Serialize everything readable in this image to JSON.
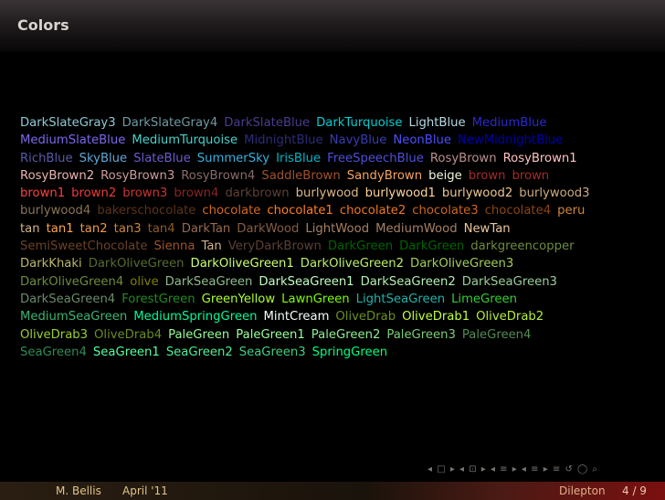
{
  "slide": {
    "title": "Colors",
    "lines": [
      [
        {
          "t": "DarkSlateGray3",
          "c": "#8fc9d6"
        },
        {
          "t": "DarkSlateGray4",
          "c": "#6e9aa3"
        },
        {
          "t": "DarkSlateBlue",
          "c": "#483d8b"
        },
        {
          "t": "DarkTurquoise",
          "c": "#00ced1"
        },
        {
          "t": "LightBlue",
          "c": "#b6d8e4"
        },
        {
          "t": "MediumBlue",
          "c": "#2a2acd"
        }
      ],
      [
        {
          "t": "MediumSlateBlue",
          "c": "#7b68ee"
        },
        {
          "t": "MediumTurquoise",
          "c": "#48d1cc"
        },
        {
          "t": "MidnightBlue",
          "c": "#2c2c7a"
        },
        {
          "t": "NavyBlue",
          "c": "#3a3ab4"
        },
        {
          "t": "NeonBlue",
          "c": "#4d4dff"
        },
        {
          "t": "NewMidnightBlue",
          "c": "#0000b0"
        }
      ],
      [
        {
          "t": "RichBlue",
          "c": "#5959ab"
        },
        {
          "t": "SkyBlue",
          "c": "#5fa6d6"
        },
        {
          "t": "SlateBlue",
          "c": "#6a5acd"
        },
        {
          "t": "SummerSky",
          "c": "#38b0de"
        },
        {
          "t": "IrisBlue",
          "c": "#03b4c8"
        },
        {
          "t": "FreeSpeechBlue",
          "c": "#4f4fd9"
        },
        {
          "t": "RosyBrown",
          "c": "#bc8f8f"
        },
        {
          "t": "RosyBrown1",
          "c": "#ffc1c1"
        }
      ],
      [
        {
          "t": "RosyBrown2",
          "c": "#eeb4b4"
        },
        {
          "t": "RosyBrown3",
          "c": "#cd9b9b"
        },
        {
          "t": "RosyBrown4",
          "c": "#8b6969"
        },
        {
          "t": "SaddleBrown",
          "c": "#a0522d"
        },
        {
          "t": "SandyBrown",
          "c": "#f4a460"
        },
        {
          "t": "beige",
          "c": "#f5f5dc"
        },
        {
          "t": "brown",
          "c": "#a52a2a"
        },
        {
          "t": "brown",
          "c": "#a52a2a"
        }
      ],
      [
        {
          "t": "brown1",
          "c": "#ff4040"
        },
        {
          "t": "brown2",
          "c": "#ee3b3b"
        },
        {
          "t": "brown3",
          "c": "#cd3333"
        },
        {
          "t": "brown4",
          "c": "#8b2323"
        },
        {
          "t": "darkbrown",
          "c": "#5c4033"
        },
        {
          "t": "burlywood",
          "c": "#deb887"
        },
        {
          "t": "burlywood1",
          "c": "#ffd39b"
        },
        {
          "t": "burlywood2",
          "c": "#eec591"
        },
        {
          "t": "burlywood3",
          "c": "#cdaa7d"
        }
      ],
      [
        {
          "t": "burlywood4",
          "c": "#8b7355"
        },
        {
          "t": "bakerschocolate",
          "c": "#5c3317"
        },
        {
          "t": "chocolate",
          "c": "#d2691e"
        },
        {
          "t": "chocolate1",
          "c": "#ff7f24"
        },
        {
          "t": "chocolate2",
          "c": "#ee7621"
        },
        {
          "t": "chocolate3",
          "c": "#cd661d"
        },
        {
          "t": "chocolate4",
          "c": "#8b4513"
        },
        {
          "t": "peru",
          "c": "#cd853f"
        }
      ],
      [
        {
          "t": "tan",
          "c": "#d2b48c"
        },
        {
          "t": "tan1",
          "c": "#ffa54f"
        },
        {
          "t": "tan2",
          "c": "#ee9a49"
        },
        {
          "t": "tan3",
          "c": "#cd853f"
        },
        {
          "t": "tan4",
          "c": "#8b5a2b"
        },
        {
          "t": "DarkTan",
          "c": "#97694f"
        },
        {
          "t": "DarkWood",
          "c": "#855e42"
        },
        {
          "t": "LightWood",
          "c": "#a68064"
        },
        {
          "t": "MediumWood",
          "c": "#a68064"
        },
        {
          "t": "NewTan",
          "c": "#ebc79e"
        }
      ],
      [
        {
          "t": "SemiSweetChocolate",
          "c": "#6b4226"
        },
        {
          "t": "Sienna",
          "c": "#a0522d"
        },
        {
          "t": "Tan",
          "c": "#d2b48c"
        },
        {
          "t": "VeryDarkBrown",
          "c": "#5c4033"
        },
        {
          "t": "DarkGreen",
          "c": "#006400"
        },
        {
          "t": "DarkGreen",
          "c": "#006400"
        },
        {
          "t": "darkgreencopper",
          "c": "#6e8b3d"
        }
      ],
      [
        {
          "t": "DarkKhaki",
          "c": "#bdb76b"
        },
        {
          "t": "DarkOliveGreen",
          "c": "#556b2f"
        },
        {
          "t": "DarkOliveGreen1",
          "c": "#caff70"
        },
        {
          "t": "DarkOliveGreen2",
          "c": "#bcee68"
        },
        {
          "t": "DarkOliveGreen3",
          "c": "#a2cd5a"
        }
      ],
      [
        {
          "t": "DarkOliveGreen4",
          "c": "#6e8b3d"
        },
        {
          "t": "olive",
          "c": "#808000"
        },
        {
          "t": "DarkSeaGreen",
          "c": "#8fbc8f"
        },
        {
          "t": "DarkSeaGreen1",
          "c": "#c1ffc1"
        },
        {
          "t": "DarkSeaGreen2",
          "c": "#b4eeb4"
        },
        {
          "t": "DarkSeaGreen3",
          "c": "#9bcd9b"
        }
      ],
      [
        {
          "t": "DarkSeaGreen4",
          "c": "#698b69"
        },
        {
          "t": "ForestGreen",
          "c": "#228b22"
        },
        {
          "t": "GreenYellow",
          "c": "#adff2f"
        },
        {
          "t": "LawnGreen",
          "c": "#7cfc00"
        },
        {
          "t": "LightSeaGreen",
          "c": "#20b2aa"
        },
        {
          "t": "LimeGreen",
          "c": "#32cd32"
        }
      ],
      [
        {
          "t": "MediumSeaGreen",
          "c": "#3cb371"
        },
        {
          "t": "MediumSpringGreen",
          "c": "#00fa9a"
        },
        {
          "t": "MintCream",
          "c": "#f5fffa"
        },
        {
          "t": "OliveDrab",
          "c": "#6b8e23"
        },
        {
          "t": "OliveDrab1",
          "c": "#c0ff3e"
        },
        {
          "t": "OliveDrab2",
          "c": "#b3ee3a"
        }
      ],
      [
        {
          "t": "OliveDrab3",
          "c": "#9acd32"
        },
        {
          "t": "OliveDrab4",
          "c": "#698b22"
        },
        {
          "t": "PaleGreen",
          "c": "#98fb98"
        },
        {
          "t": "PaleGreen1",
          "c": "#9aff9a"
        },
        {
          "t": "PaleGreen2",
          "c": "#90ee90"
        },
        {
          "t": "PaleGreen3",
          "c": "#7ccd7c"
        },
        {
          "t": "PaleGreen4",
          "c": "#548b54"
        }
      ],
      [
        {
          "t": "SeaGreen4",
          "c": "#2e8b57"
        },
        {
          "t": "SeaGreen1",
          "c": "#54ff9f"
        },
        {
          "t": "SeaGreen2",
          "c": "#4eee94"
        },
        {
          "t": "SeaGreen3",
          "c": "#43cd80"
        },
        {
          "t": "SpringGreen",
          "c": "#00ff7f"
        }
      ]
    ]
  },
  "navigation": {
    "symbols": "◂ □ ▸ ◂ ⊡ ▸ ◂ ≡ ▸ ◂ ≡ ▸ ≡ ↺ ◯ ⌕"
  },
  "footer": {
    "author": "M. Bellis",
    "date": "April '11",
    "short_title": "Dilepton",
    "page": "4 / 9"
  }
}
